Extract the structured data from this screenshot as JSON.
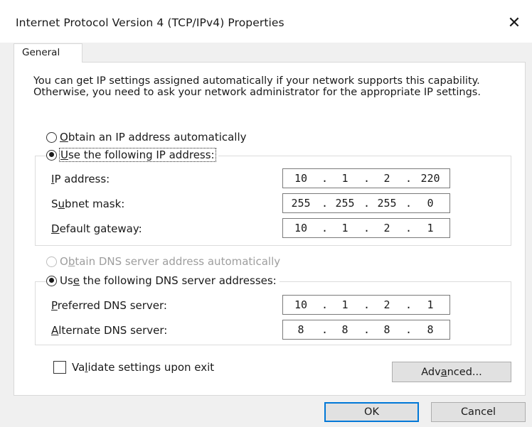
{
  "window": {
    "title": "Internet Protocol Version 4 (TCP/IPv4) Properties",
    "close_glyph": "✕",
    "close_icon": "close-icon"
  },
  "tabs": [
    {
      "label": "General",
      "selected": true
    }
  ],
  "intro_text": "You can get IP settings assigned automatically if your network supports this capability. Otherwise, you need to ask your network administrator for the appropriate IP settings.",
  "ip_section": {
    "auto_option": {
      "label_hotkey": "O",
      "label_rest": "btain an IP address automatically",
      "selected": false
    },
    "manual_option": {
      "label_hotkey": "U",
      "label_rest": "se the following IP address:",
      "selected": true
    },
    "fields": [
      {
        "label_before": "",
        "label_hotkey": "I",
        "label_after": "P address:",
        "octets": [
          "10",
          "1",
          "2",
          "220"
        ]
      },
      {
        "label_before": "S",
        "label_hotkey": "u",
        "label_after": "bnet mask:",
        "octets": [
          "255",
          "255",
          "255",
          "0"
        ]
      },
      {
        "label_before": "",
        "label_hotkey": "D",
        "label_after": "efault gateway:",
        "octets": [
          "10",
          "1",
          "2",
          "1"
        ]
      }
    ]
  },
  "dns_section": {
    "auto_option": {
      "label_before": "O",
      "label_hotkey": "b",
      "label_after": "tain DNS server address automatically",
      "selected": false,
      "enabled": false
    },
    "manual_option": {
      "label_before": "Us",
      "label_hotkey": "e",
      "label_after": " the following DNS server addresses:",
      "selected": true
    },
    "fields": [
      {
        "label_before": "",
        "label_hotkey": "P",
        "label_after": "referred DNS server:",
        "octets": [
          "10",
          "1",
          "2",
          "1"
        ]
      },
      {
        "label_before": "",
        "label_hotkey": "A",
        "label_after": "lternate DNS server:",
        "octets": [
          "8",
          "8",
          "8",
          "8"
        ]
      }
    ]
  },
  "validate": {
    "label_before": "Va",
    "label_hotkey": "l",
    "label_after": "idate settings upon exit",
    "checked": false
  },
  "buttons": {
    "advanced": {
      "label_before": "Adv",
      "label_hotkey": "a",
      "label_after": "nced..."
    },
    "ok": "OK",
    "cancel": "Cancel"
  },
  "colors": {
    "focus_border": "#0078d7",
    "background": "#f0f0f0",
    "panel": "#ffffff"
  }
}
